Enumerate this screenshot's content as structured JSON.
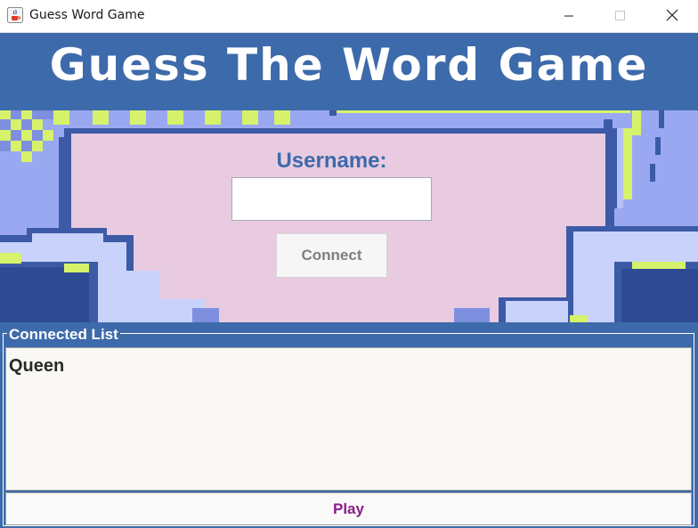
{
  "window": {
    "title": "Guess Word Game",
    "icon": "java-cup-icon",
    "controls": [
      "minimize-icon",
      "maximize-icon",
      "close-icon"
    ]
  },
  "header": {
    "title": "Guess The Word Game"
  },
  "login": {
    "label": "Username:",
    "username_value": "",
    "connect_label": "Connect"
  },
  "connected": {
    "legend": "Connected List",
    "items": [
      "Queen"
    ]
  },
  "actions": {
    "play_label": "Play"
  },
  "colors": {
    "header_bg": "#3d6aaa",
    "scene_sky": "#9aa8f2",
    "board_pink": "#e8cbe0",
    "pixel_lime": "#d6f26a",
    "pixel_navy": "#3c5aa6",
    "cloud_light": "#c8d2fa",
    "list_bg": "#f9f8f4",
    "play_text": "#8b1c86"
  }
}
